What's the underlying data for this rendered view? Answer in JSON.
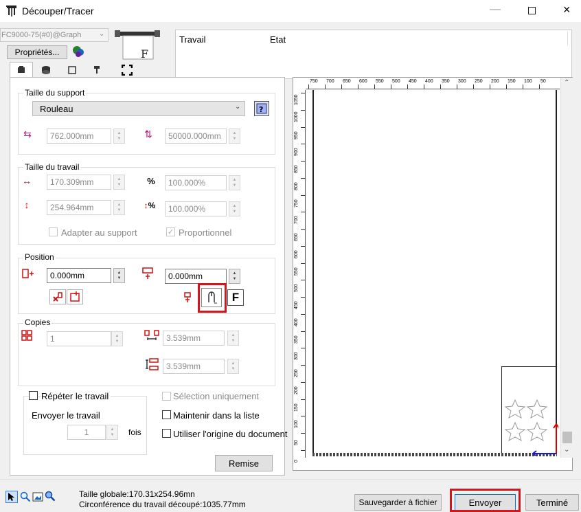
{
  "window": {
    "title": "Découper/Tracer"
  },
  "device": {
    "selected": "FC9000-75(#0)@Graph",
    "properties_label": "Propriétés..."
  },
  "jobs": {
    "col_job": "Travail",
    "col_state": "Etat"
  },
  "support_size": {
    "group_label": "Taille du support",
    "media_type": "Rouleau",
    "width": "762.000mm",
    "length": "50000.000mm"
  },
  "job_size": {
    "group_label": "Taille du travail",
    "width": "170.309mm",
    "width_pct": "100.000%",
    "height": "254.964mm",
    "height_pct": "100.000%",
    "fit_label": "Adapter au support",
    "proportional_label": "Proportionnel"
  },
  "position": {
    "group_label": "Position",
    "x": "0.000mm",
    "y": "0.000mm",
    "f_label": "F"
  },
  "copies": {
    "group_label": "Copies",
    "count": "1",
    "spacing_x": "3.539mm",
    "spacing_y": "3.539mm"
  },
  "options": {
    "repeat_label": "Répéter le travail",
    "send_label": "Envoyer le travail",
    "send_times": "1",
    "times_label": "fois",
    "selection_only_label": "Sélection uniquement",
    "keep_in_list_label": "Maintenir dans la liste",
    "use_origin_label": "Utiliser l'origine du document",
    "reset_label": "Remise"
  },
  "ruler": {
    "horizontal": [
      "750",
      "700",
      "650",
      "600",
      "550",
      "500",
      "450",
      "400",
      "350",
      "300",
      "250",
      "200",
      "150",
      "100",
      "50"
    ],
    "vertical": [
      "1050",
      "1000",
      "950",
      "900",
      "850",
      "800",
      "750",
      "700",
      "650",
      "600",
      "550",
      "500",
      "450",
      "400",
      "350",
      "300",
      "250",
      "200",
      "150",
      "100",
      "50",
      "0"
    ]
  },
  "status": {
    "overall_size": "Taille globale:170.31x254.96mn",
    "perimeter": "Circonférence du travail découpé:1035.77mm"
  },
  "actions": {
    "save_file": "Sauvegarder à fichier",
    "send": "Envoyer",
    "done": "Terminé"
  },
  "colors": {
    "highlight": "#d2161e",
    "origin_x": "#1a1ad6",
    "origin_y": "#e00000"
  }
}
